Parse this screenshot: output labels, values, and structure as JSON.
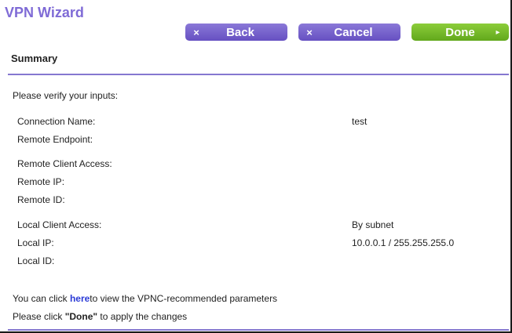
{
  "wizard": {
    "title": "VPN Wizard"
  },
  "buttons": {
    "back": "Back",
    "cancel": "Cancel",
    "done": "Done",
    "x_glyph": "×",
    "arrow_glyph": "▸"
  },
  "summary": {
    "title": "Summary",
    "verify_prompt": "Please verify your inputs:",
    "fields": {
      "connection_name": {
        "label": "Connection Name:",
        "value": "test"
      },
      "remote_endpoint": {
        "label": "Remote Endpoint:",
        "value": ""
      },
      "remote_client_access": {
        "label": "Remote Client Access:",
        "value": ""
      },
      "remote_ip": {
        "label": "Remote IP:",
        "value": ""
      },
      "remote_id": {
        "label": "Remote ID:",
        "value": ""
      },
      "local_client_access": {
        "label": "Local Client Access:",
        "value": "By subnet"
      },
      "local_ip": {
        "label": "Local IP:",
        "value": "10.0.0.1 / 255.255.255.0"
      },
      "local_id": {
        "label": "Local ID:",
        "value": ""
      }
    }
  },
  "footer": {
    "click_prefix": "You can click ",
    "here_link": "here",
    "click_suffix": "to view the VPNC-recommended parameters",
    "apply_prefix": "Please click ",
    "apply_done": "\"Done\"",
    "apply_suffix": " to apply the changes"
  },
  "colors": {
    "accent_purple": "#7f6bd6",
    "button_purple": "#6650c2",
    "button_green": "#62a81c",
    "link_blue": "#2a3ad6"
  }
}
